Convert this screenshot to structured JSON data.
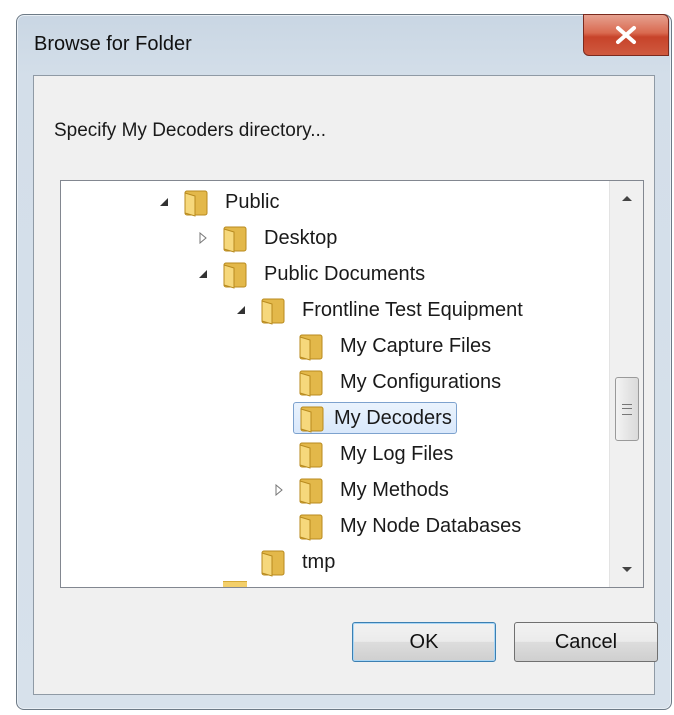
{
  "dialog": {
    "title": "Browse for Folder",
    "instruction": "Specify My Decoders directory...",
    "ok_label": "OK",
    "cancel_label": "Cancel"
  },
  "tree": {
    "items": [
      {
        "label": "Public",
        "expander": "expanded"
      },
      {
        "label": "Desktop",
        "expander": "collapsed"
      },
      {
        "label": "Public Documents",
        "expander": "expanded"
      },
      {
        "label": "Frontline Test Equipment",
        "expander": "expanded"
      },
      {
        "label": "My Capture Files",
        "expander": "none"
      },
      {
        "label": "My Configurations",
        "expander": "none"
      },
      {
        "label": "My Decoders",
        "expander": "none",
        "selected": true
      },
      {
        "label": "My Log Files",
        "expander": "none"
      },
      {
        "label": "My Methods",
        "expander": "collapsed"
      },
      {
        "label": "My Node Databases",
        "expander": "none"
      },
      {
        "label": "tmp",
        "expander": "none"
      }
    ]
  },
  "icons": {
    "close": "close-icon",
    "folder": "folder-icon",
    "expanded": "expanded-triangle-icon",
    "collapsed": "collapsed-triangle-icon",
    "scroll_up": "scroll-up-arrow-icon",
    "scroll_down": "scroll-down-arrow-icon"
  },
  "colors": {
    "selection_border": "#7da2ce",
    "close_button": "#c7432a",
    "default_button_border": "#3c7fb1"
  }
}
